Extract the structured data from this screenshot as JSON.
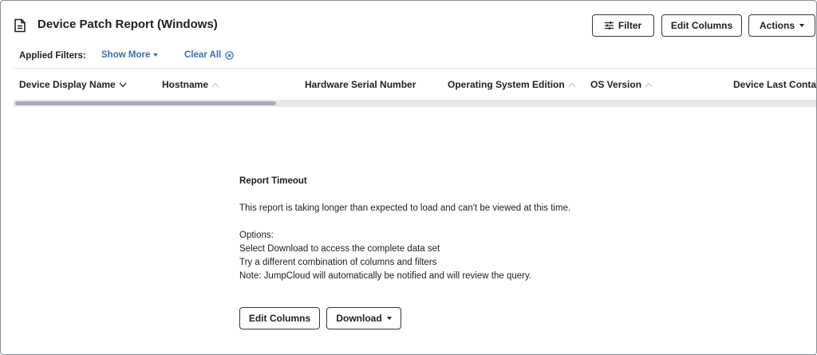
{
  "header": {
    "title": "Device Patch Report (Windows)",
    "filter_label": "Filter",
    "edit_columns_label": "Edit Columns",
    "actions_label": "Actions"
  },
  "filters": {
    "label": "Applied Filters:",
    "show_more": "Show More",
    "clear_all": "Clear All"
  },
  "table": {
    "columns": [
      "Device Display Name",
      "Hostname",
      "Hardware Serial Number",
      "Operating System Edition",
      "OS Version",
      "Device Last Contact"
    ]
  },
  "timeout": {
    "title": "Report Timeout",
    "message": "This report is taking longer than expected to load and can't be viewed at this time.",
    "options_label": "Options:",
    "options": [
      "Select Download to access the complete data set",
      "Try a different combination of columns and filters",
      "Note: JumpCloud will automatically be notified and will review the query."
    ],
    "edit_columns_label": "Edit Columns",
    "download_label": "Download"
  },
  "colors": {
    "link": "#3a6fb0",
    "button_border": "#2b3a4e",
    "scroll_thumb": "#a9adb3"
  },
  "icons": {
    "title": "document-icon",
    "filter": "sliders-icon",
    "clear": "close-circle-icon"
  }
}
